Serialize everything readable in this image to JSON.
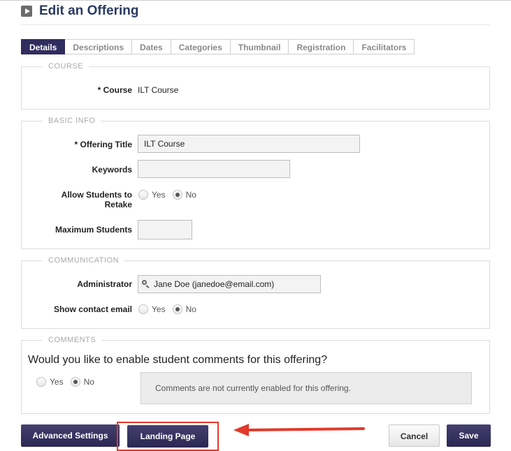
{
  "header": {
    "title": "Edit an Offering",
    "icon": "play-icon"
  },
  "tabs": [
    {
      "label": "Details",
      "active": true
    },
    {
      "label": "Descriptions",
      "active": false
    },
    {
      "label": "Dates",
      "active": false
    },
    {
      "label": "Categories",
      "active": false
    },
    {
      "label": "Thumbnail",
      "active": false
    },
    {
      "label": "Registration",
      "active": false
    },
    {
      "label": "Facilitators",
      "active": false
    }
  ],
  "course": {
    "legend": "COURSE",
    "label": "* Course",
    "value": "ILT Course"
  },
  "basic_info": {
    "legend": "BASIC INFO",
    "offering_title_label": "* Offering Title",
    "offering_title_value": "ILT Course",
    "keywords_label": "Keywords",
    "keywords_value": "",
    "retake_label_line1": "Allow Students to",
    "retake_label_line2": "Retake",
    "retake_yes": "Yes",
    "retake_no": "No",
    "retake_selected": "No",
    "max_students_label": "Maximum Students",
    "max_students_value": ""
  },
  "communication": {
    "legend": "COMMUNICATION",
    "administrator_label": "Administrator",
    "administrator_value": "Jane Doe (janedoe@email.com)",
    "show_email_label": "Show contact email",
    "show_email_yes": "Yes",
    "show_email_no": "No",
    "show_email_selected": "No"
  },
  "comments": {
    "legend": "COMMENTS",
    "question": "Would you like to enable student comments for this offering?",
    "yes": "Yes",
    "no": "No",
    "selected": "No",
    "notice": "Comments are not currently enabled for this offering."
  },
  "footer": {
    "advanced_settings": "Advanced Settings",
    "landing_page": "Landing Page",
    "cancel": "Cancel",
    "save": "Save"
  },
  "colors": {
    "accent": "#2f2d5e",
    "title": "#2a3a63",
    "highlight": "#e2392a"
  }
}
